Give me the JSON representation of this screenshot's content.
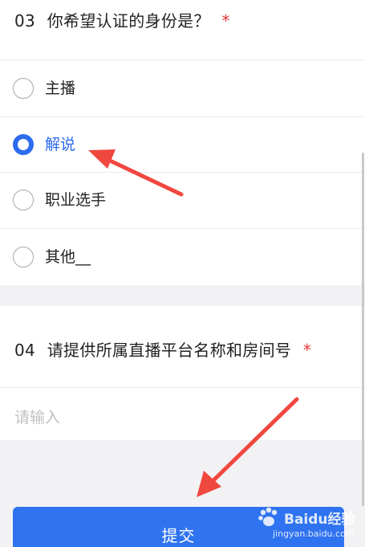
{
  "q3": {
    "number": "03",
    "title": "你希望认证的身份是？",
    "required_mark": "*",
    "options": [
      {
        "label": "主播",
        "selected": false
      },
      {
        "label": "解说",
        "selected": true
      },
      {
        "label": "职业选手",
        "selected": false
      },
      {
        "label": "其他__",
        "selected": false
      }
    ]
  },
  "q4": {
    "number": "04",
    "title": "请提供所属直播平台名称和房间号",
    "required_mark": "*",
    "input": {
      "value": "",
      "placeholder": "请输入"
    }
  },
  "submit": {
    "label": "提交"
  },
  "watermark": {
    "brand": "Baidu经验",
    "site": "jingyan.baidu.com"
  },
  "colors": {
    "accent": "#2d6bef",
    "button": "#2f73f0",
    "required": "#e53935",
    "arrow": "#f0473f"
  }
}
